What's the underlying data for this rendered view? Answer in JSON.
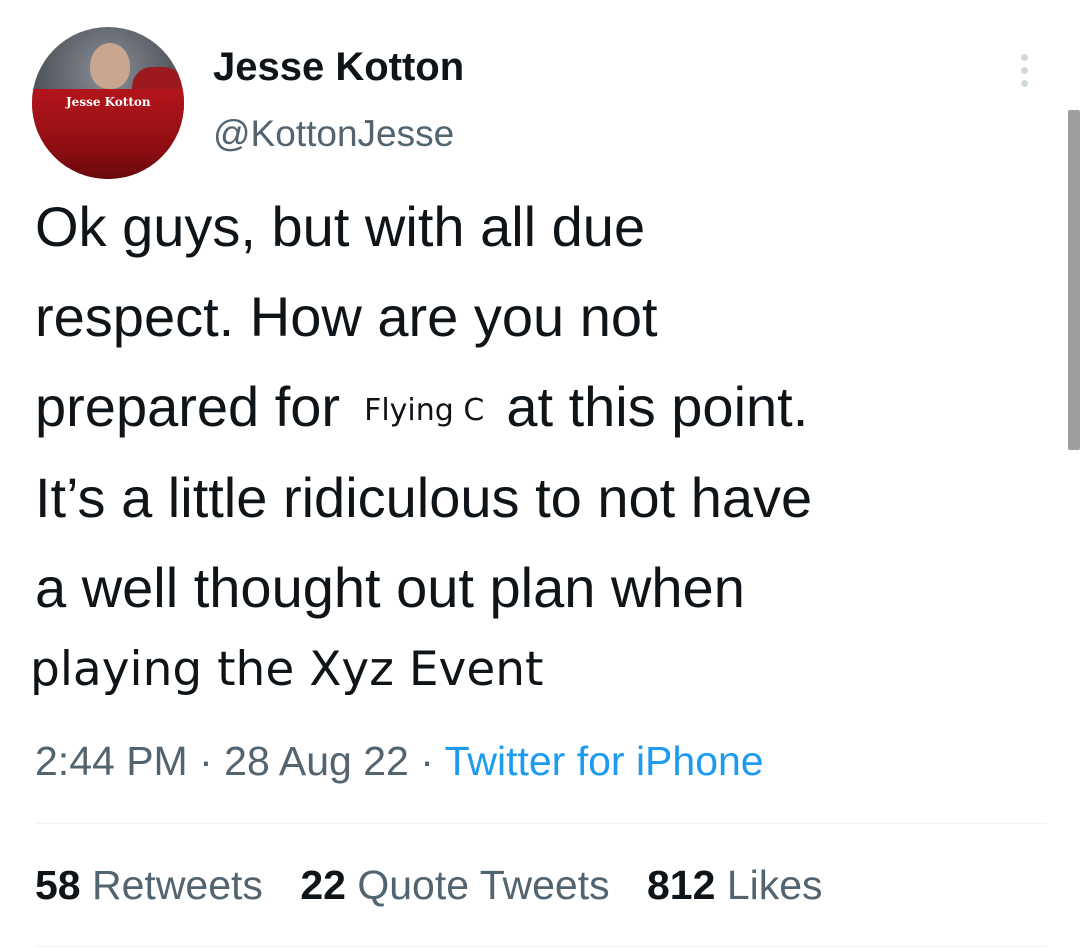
{
  "author": {
    "name": "Jesse Kotton",
    "handle": "@KottonJesse",
    "avatar_caption": "Jesse Kotton"
  },
  "tweet": {
    "line1": "Ok guys, but with all due",
    "line2": "respect. How are you not",
    "line3_start": "prepared for",
    "line3_insert": "Flying C",
    "line3_end": "at this point.",
    "line4": "It’s a little ridiculous to not have",
    "line5": "a well thought out plan when",
    "line6": "playing the Xyz Event"
  },
  "meta": {
    "time": "2:44 PM",
    "sep1": "·",
    "date": "28 Aug 22",
    "sep2": "·",
    "source": "Twitter for iPhone"
  },
  "stats": {
    "retweets_count": "58",
    "retweets_label": "Retweets",
    "quotes_count": "22",
    "quotes_label": "Quote Tweets",
    "likes_count": "812",
    "likes_label": "Likes"
  },
  "icons": {
    "more": "more-vertical-icon"
  },
  "colors": {
    "text": "#0f1419",
    "secondary": "#536471",
    "link": "#1d9bf0"
  }
}
